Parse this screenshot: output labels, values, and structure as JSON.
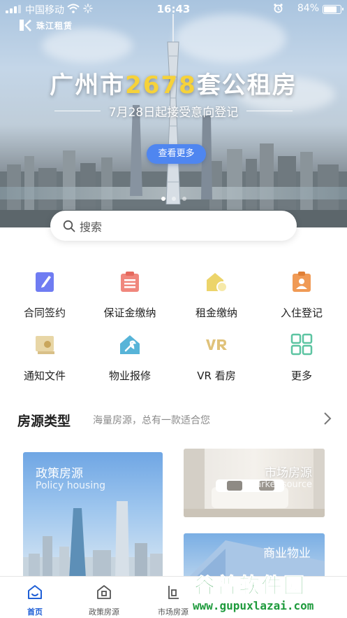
{
  "status_bar": {
    "carrier": "中国移动",
    "time": "16:43",
    "battery_percent": "84%",
    "battery_level": 0.84,
    "icons": [
      "signal-icon",
      "wifi-icon",
      "loading-icon",
      "alarm-icon",
      "battery-icon"
    ]
  },
  "banner": {
    "logo_text": "珠江租赁",
    "headline_prefix": "广州市",
    "headline_number": "2678",
    "headline_suffix": "套公租房",
    "subline": "7月28日起接受意向登记",
    "cta_label": "查看更多",
    "slide_count": 3,
    "active_slide": 0
  },
  "search": {
    "placeholder": "搜索"
  },
  "quick_actions": [
    {
      "label": "合同签约",
      "icon": "contract-sign-icon"
    },
    {
      "label": "保证金缴纳",
      "icon": "deposit-payment-icon"
    },
    {
      "label": "租金缴纳",
      "icon": "rent-payment-icon"
    },
    {
      "label": "入住登记",
      "icon": "checkin-register-icon"
    },
    {
      "label": "通知文件",
      "icon": "notice-document-icon"
    },
    {
      "label": "物业报修",
      "icon": "property-repair-icon"
    },
    {
      "label": "VR 看房",
      "icon": "vr-viewing-icon"
    },
    {
      "label": "更多",
      "icon": "more-grid-icon"
    }
  ],
  "section": {
    "title": "房源类型",
    "subtitle": "海量房源，总有一款适合您"
  },
  "cards": {
    "policy": {
      "title": "政策房源",
      "subtitle": "Policy housing"
    },
    "market": {
      "title": "市场房源",
      "subtitle": "Market source"
    },
    "commercial": {
      "title": "商业物业"
    }
  },
  "tabs": [
    {
      "label": "首页",
      "icon": "home-icon",
      "active": true
    },
    {
      "label": "政策房源",
      "icon": "policy-housing-icon",
      "active": false
    },
    {
      "label": "市场房源",
      "icon": "market-housing-icon",
      "active": false
    }
  ],
  "watermark": {
    "main": "谷普软件园",
    "url": "www.gupuxlazai.com"
  },
  "colors": {
    "accent": "#4f86f0",
    "tab_active": "#1f5fd6",
    "headline_highlight": "#f6d23a"
  }
}
